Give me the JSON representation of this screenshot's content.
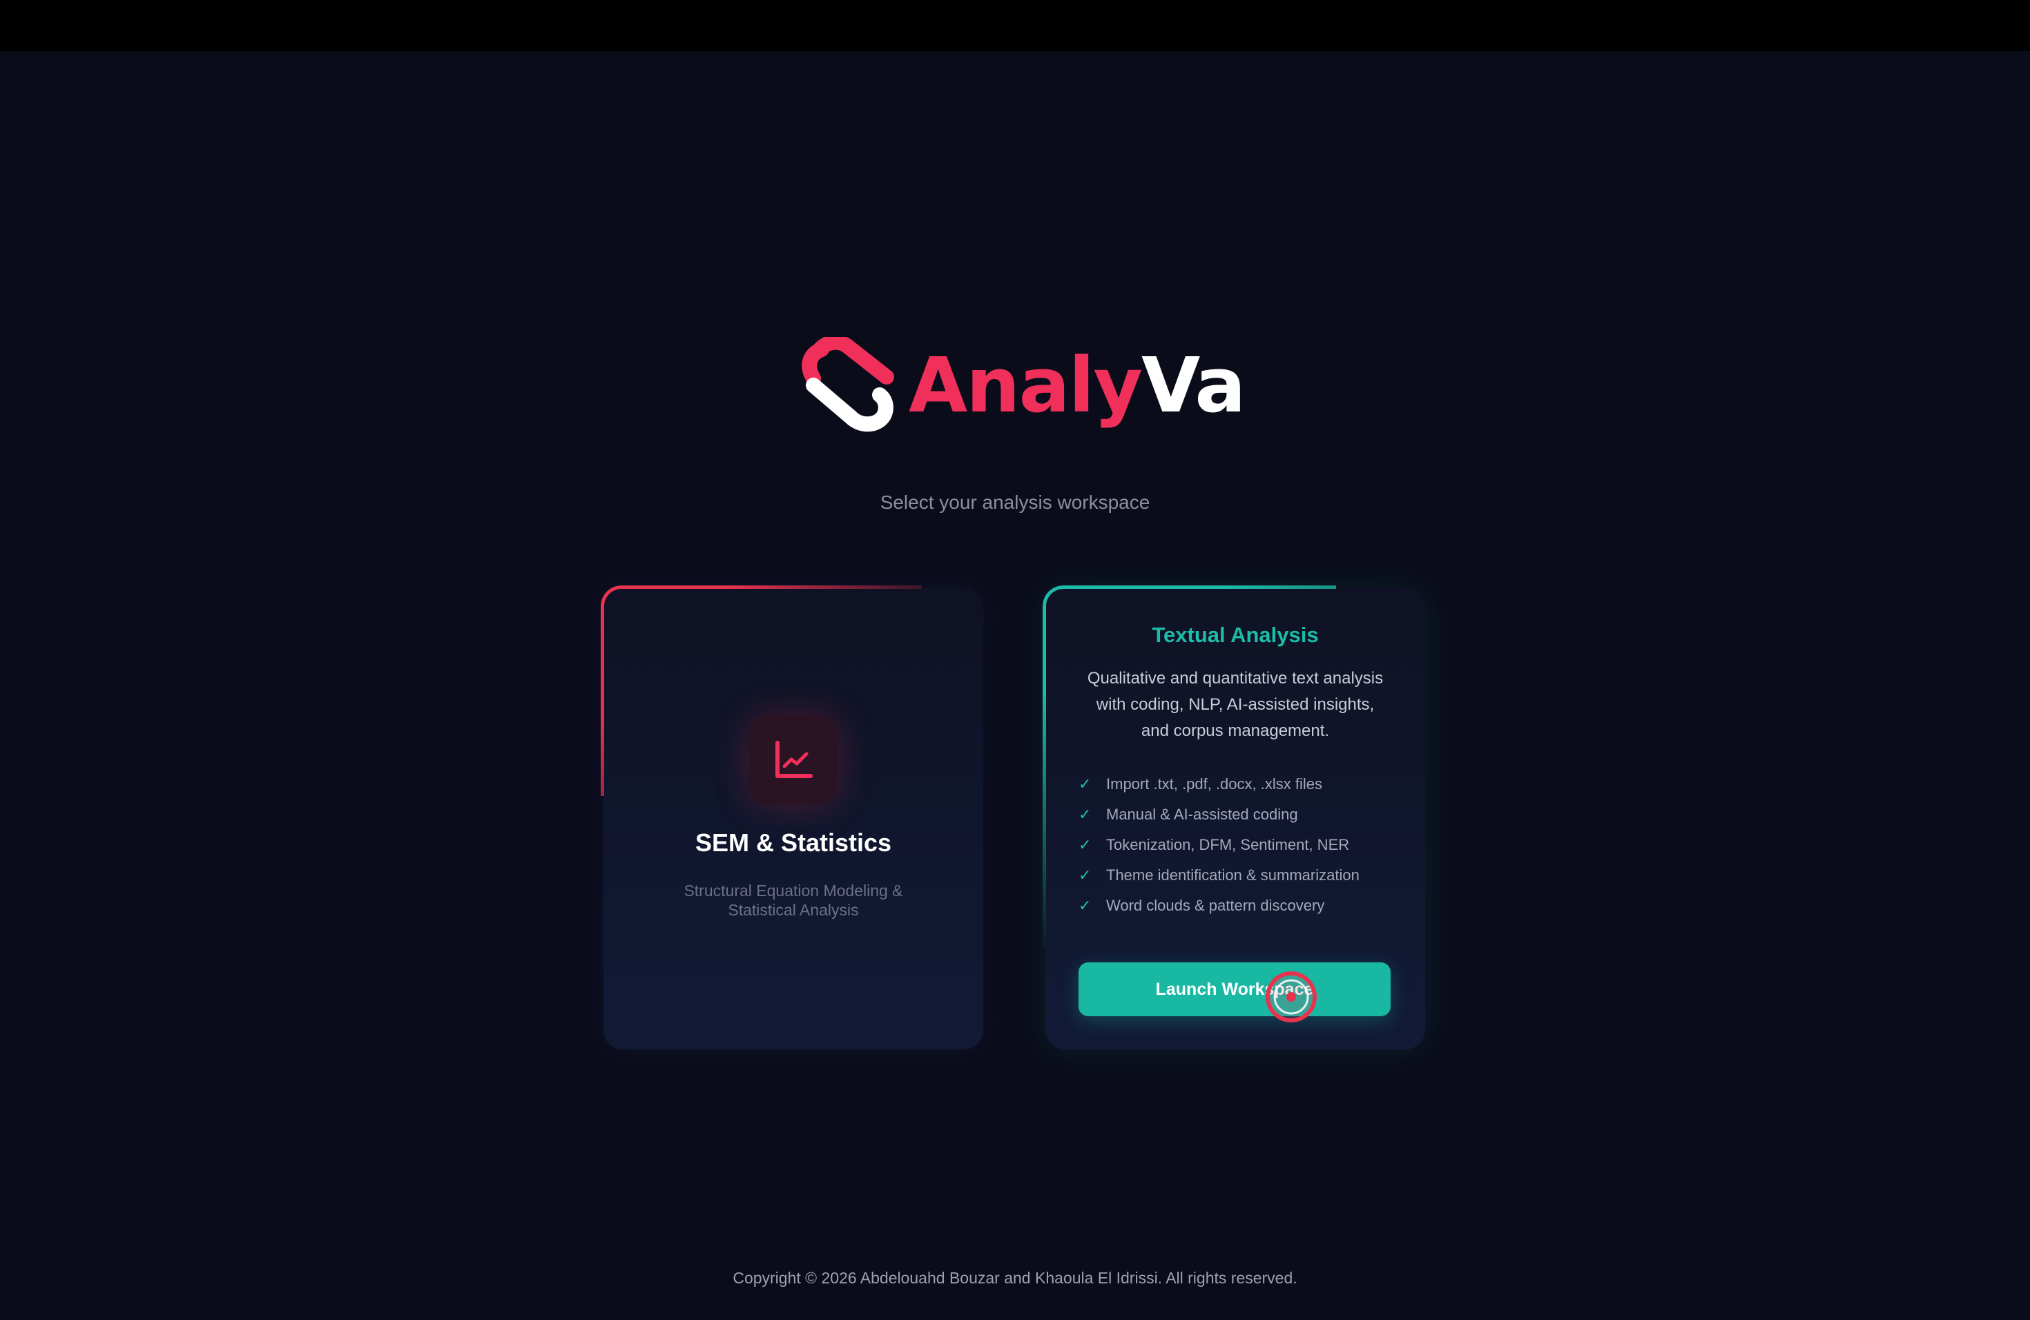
{
  "brand": {
    "name_part1": "Analy",
    "name_part2": "Va",
    "primary_color": "#f0305a",
    "accent_color": "#1dbca8"
  },
  "subtitle": "Select your analysis workspace",
  "cards": {
    "sem": {
      "icon": "line-chart-icon",
      "title": "SEM & Statistics",
      "description": "Structural Equation Modeling & Statistical Analysis"
    },
    "textual": {
      "title": "Textual Analysis",
      "description": "Qualitative and quantitative text analysis with coding, NLP, AI-assisted insights, and corpus management.",
      "features": [
        "Import .txt, .pdf, .docx, .xlsx files",
        "Manual & AI-assisted coding",
        "Tokenization, DFM, Sentiment, NER",
        "Theme identification & summarization",
        "Word clouds & pattern discovery"
      ],
      "button_label": "Launch Workspace"
    }
  },
  "footer": "Copyright © 2026 Abdelouahd Bouzar and Khaoula El Idrissi. All rights reserved."
}
